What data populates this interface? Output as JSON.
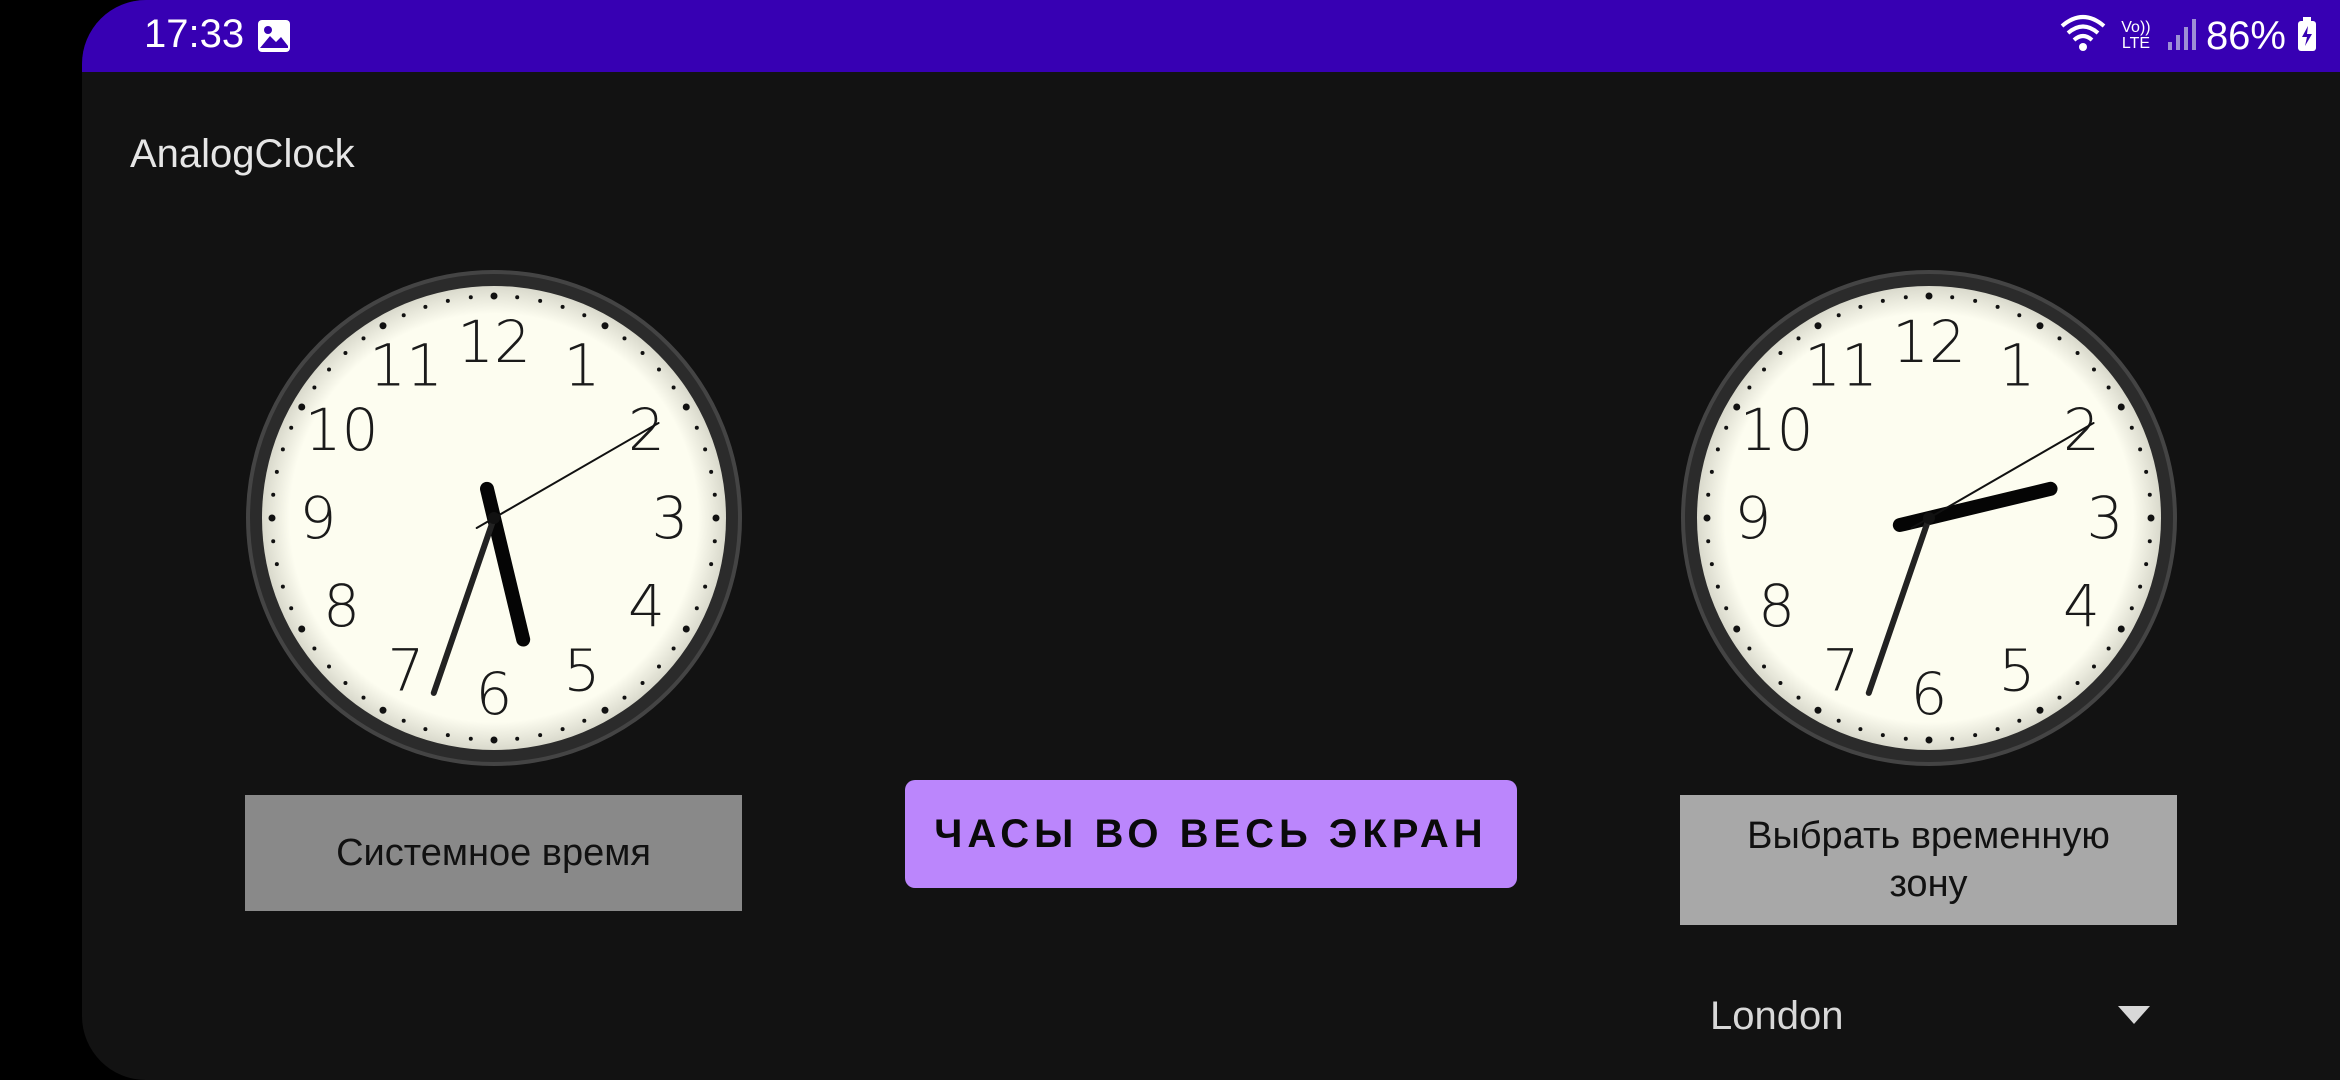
{
  "status_bar": {
    "time": "17:33",
    "battery_percent": "86%",
    "network_label": "Vo)) LTE"
  },
  "app": {
    "title": "AnalogClock"
  },
  "clocks": {
    "left": {
      "hour": 5,
      "minute": 33,
      "second": 10
    },
    "right": {
      "hour": 2,
      "minute": 33,
      "second": 10
    },
    "numerals": [
      "12",
      "1",
      "2",
      "3",
      "4",
      "5",
      "6",
      "7",
      "8",
      "9",
      "10",
      "11"
    ]
  },
  "buttons": {
    "system_time": "Системное время",
    "fullscreen": "ЧАСЫ ВО ВЕСЬ ЭКРАН",
    "choose_zone": "Выбрать временную зону"
  },
  "timezone_spinner": {
    "value": "London"
  },
  "colors": {
    "status_bar": "#3700b3",
    "background": "#121212",
    "accent_button": "#bb86fc",
    "clock_face": "#fdfdf0"
  }
}
